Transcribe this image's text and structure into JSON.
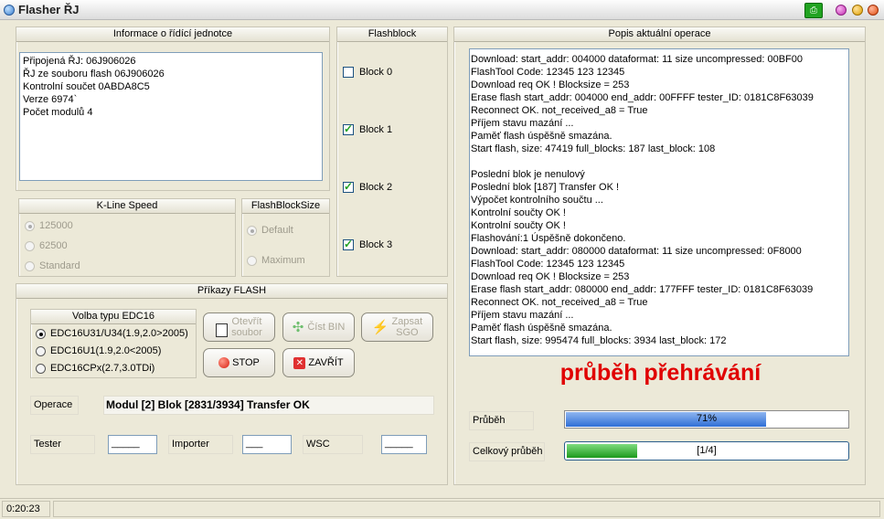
{
  "window": {
    "title": "Flasher ŘJ"
  },
  "info": {
    "heading": "Informace o řídící jednotce",
    "lines": [
      "Připojená ŘJ: 06J906026",
      "ŘJ ze  souboru flash 06J906026",
      "Kontrolní součet 0ABDA8C5",
      "Verze 6974`",
      "Počet modulů 4"
    ]
  },
  "kline": {
    "heading": "K-Line Speed",
    "options": [
      "125000",
      "62500",
      "Standard"
    ],
    "selected": "125000"
  },
  "blocksize": {
    "heading": "FlashBlockSize",
    "options": [
      "Default",
      "Maximum"
    ],
    "selected": "Default"
  },
  "flashblock": {
    "heading": "Flashblock",
    "blocks": [
      {
        "label": "Block 0",
        "checked": false
      },
      {
        "label": "Block 1",
        "checked": true
      },
      {
        "label": "Block 2",
        "checked": true
      },
      {
        "label": "Block 3",
        "checked": true
      }
    ]
  },
  "commands": {
    "heading": "Příkazy FLASH",
    "edc_heading": "Volba typu EDC16",
    "edc_options": [
      "EDC16U31/U34(1.9,2.0>2005)",
      "EDC16U1(1.9,2.0<2005)",
      "EDC16CPx(2.7,3.0TDi)"
    ],
    "edc_selected": "EDC16U31/U34(1.9,2.0>2005)",
    "open_line1": "Otevřít",
    "open_line2": "soubor",
    "read_label": "Číst BIN",
    "write_line1": "Zapsat",
    "write_line2": "SGO",
    "stop_label": "STOP",
    "close_label": "ZAVŘÍT",
    "operation_label": "Operace",
    "operation_value": "Modul [2] Blok [2831/3934] Transfer OK",
    "tester_label": "Tester",
    "tester_value": "_____",
    "importer_label": "Importer",
    "importer_value": "___",
    "wsc_label": "WSC",
    "wsc_value": "_____"
  },
  "log": {
    "heading": "Popis aktuální operace",
    "lines": [
      "Download: start_addr: 004000 dataformat: 11 size uncompressed: 00BF00",
      "FlashTool Code: 12345 123 12345",
      "Download req OK ! Blocksize = 253",
      "Erase flash start_addr: 004000 end_addr: 00FFFF tester_ID: 0181C8F63039",
      "Reconnect OK. not_received_a8 = True",
      "Příjem stavu mazání ...",
      "Paměť flash úspěšně smazána.",
      "Start flash, size: 47419 full_blocks: 187 last_block: 108",
      "",
      "Poslední blok je nenulový",
      "Poslední blok [187] Transfer OK !",
      "Výpočet kontrolního součtu ...",
      "Kontrolní součty OK !",
      "Kontrolní součty OK !",
      "Flashování:1 Úspěšně dokončeno.",
      "Download: start_addr: 080000 dataformat: 11 size uncompressed: 0F8000",
      "FlashTool Code: 12345 123 12345",
      "Download req OK ! Blocksize = 253",
      "Erase flash start_addr: 080000 end_addr: 177FFF tester_ID: 0181C8F63039",
      "Reconnect OK. not_received_a8 = True",
      "Příjem stavu mazání ...",
      "Paměť flash úspěšně smazána.",
      "Start flash, size: 995474 full_blocks: 3934 last_block: 172"
    ]
  },
  "progress": {
    "banner": "průběh přehrávání",
    "banner_color": "#e00000",
    "progress_label": "Průběh",
    "progress_text": "71%",
    "progress_fraction": 0.71,
    "progress_color": "#2f6fd6",
    "total_label": "Celkový průběh",
    "total_text": "[1/4]",
    "total_fraction": 0.25,
    "total_color": "#1c9a1c"
  },
  "status": {
    "time": "0:20:23"
  }
}
